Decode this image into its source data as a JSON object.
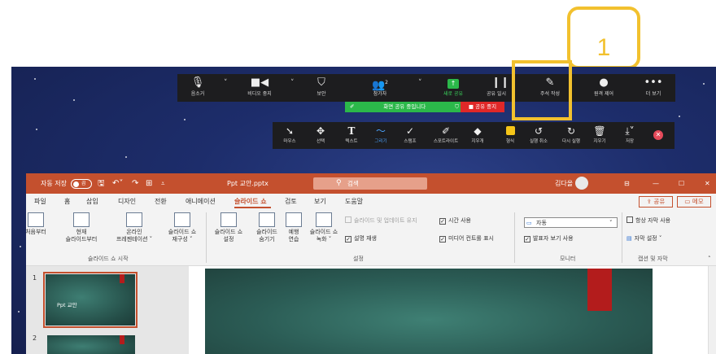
{
  "callout": {
    "number": "1",
    "color": "#f2c12e"
  },
  "zoom_toolbar": {
    "mute": "음소거",
    "video": "비디오 중지",
    "security": "보안",
    "participants": "참가자",
    "participants_count": "2",
    "new_share": "새로 공유",
    "pause_share": "공유 일시",
    "annotate": "주석 작성",
    "remote_control": "원격 제어",
    "more": "더 보기",
    "sharing_banner": "화면 공유 중입니다",
    "stop_share": "■ 공유 중지"
  },
  "annotation_toolbar": {
    "mouse": "마우스",
    "select": "선택",
    "text": "텍스트",
    "draw": "그리기",
    "stamp": "스탬프",
    "spotlight": "스포트라이트",
    "eraser": "지우개",
    "format": "형식",
    "undo": "실행 취소",
    "redo": "다시 실행",
    "clear": "지우기",
    "save": "저장"
  },
  "powerpoint": {
    "autosave": "자동 저장",
    "autosave_state": "끔",
    "filename": "Ppt 교안.pptx",
    "search": "검색",
    "user": "김다올",
    "accent": "#c4502e",
    "menus": [
      "파일",
      "홈",
      "삽입",
      "디자인",
      "전환",
      "애니메이션",
      "슬라이드 쇼",
      "검토",
      "보기",
      "도움말"
    ],
    "share": "공유",
    "memo": "메모",
    "ribbon": {
      "from_start": "처음부터",
      "from_current_1": "현재",
      "from_current_2": "슬라이드부터",
      "online_1": "온라인",
      "online_2": "프레젠테이션 ˅",
      "custom_1": "슬라이드 쇼",
      "custom_2": "재구성 ˅",
      "setup_1": "슬라이드 쇼",
      "setup_2": "설정",
      "hide_1": "슬라이드",
      "hide_2": "숨기기",
      "rehearse_1": "예행",
      "rehearse_2": "연습",
      "record_1": "슬라이드 쇼",
      "record_2": "녹화 ˅",
      "group_start": "슬라이드 쇼 시작",
      "group_setup": "설정",
      "update_slide": "슬라이드 및 업데이트 유지",
      "use_timings": "시간 사용",
      "play_narration": "설명 재생",
      "media_controls": "미디어 컨트롤 표시",
      "monitor": "자동",
      "presenter_view": "발표자 보기 사용",
      "group_monitor": "모니터",
      "always_captions": "항상 자막 사용",
      "caption_settings": "자막 설정 ˅",
      "group_captions": "캡션 및 자막"
    },
    "slides": [
      {
        "num": "1",
        "title": "Ppt 교안"
      },
      {
        "num": "2",
        "title": ""
      }
    ]
  }
}
